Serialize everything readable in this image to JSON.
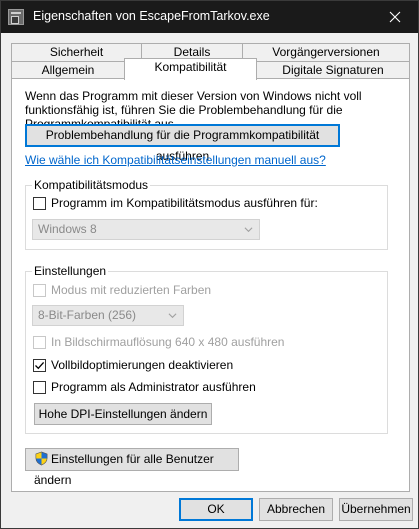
{
  "window": {
    "title": "Eigenschaften von EscapeFromTarkov.exe"
  },
  "tabs_row1": [
    "Sicherheit",
    "Details",
    "Vorgängerversionen"
  ],
  "tabs_row2": [
    "Allgemein",
    "Kompatibilität",
    "Digitale Signaturen"
  ],
  "active_tab": "Kompatibilität",
  "description": "Wenn das Programm mit dieser Version von Windows nicht voll funktionsfähig ist, führen Sie die Problembehandlung für die Programmkompatibilität aus.",
  "troubleshoot_button": "Problembehandlung für die Programmkompatibilität ausführen",
  "manual_link": "Wie wähle ich Kompatibilitätseinstellungen manuell aus?",
  "compat_mode": {
    "group_label": "Kompatibilitätsmodus",
    "checkbox_label": "Programm im Kompatibilitätsmodus ausführen für:",
    "checked": false,
    "selected_os": "Windows 8"
  },
  "settings": {
    "group_label": "Einstellungen",
    "reduced_colors_label": "Modus mit reduzierten Farben",
    "color_depth": "8-Bit-Farben (256)",
    "low_res_label": "In Bildschirmauflösung 640 x 480 ausführen",
    "fullscreen_opt_label": "Vollbildoptimierungen deaktivieren",
    "fullscreen_opt_checked": true,
    "admin_label": "Programm als Administrator ausführen",
    "admin_checked": false,
    "dpi_button": "Hohe DPI-Einstellungen ändern"
  },
  "all_users_button": "Einstellungen für alle Benutzer ändern",
  "footer": {
    "ok": "OK",
    "cancel": "Abbrechen",
    "apply": "Übernehmen"
  },
  "colors": {
    "link": "#0066cc",
    "titlebar": "#1a1a1a",
    "default_button_border": "#0078d7"
  },
  "icons": [
    "application-icon",
    "close-icon",
    "checkmark-icon",
    "chevron-down-icon",
    "uac-shield-icon"
  ]
}
